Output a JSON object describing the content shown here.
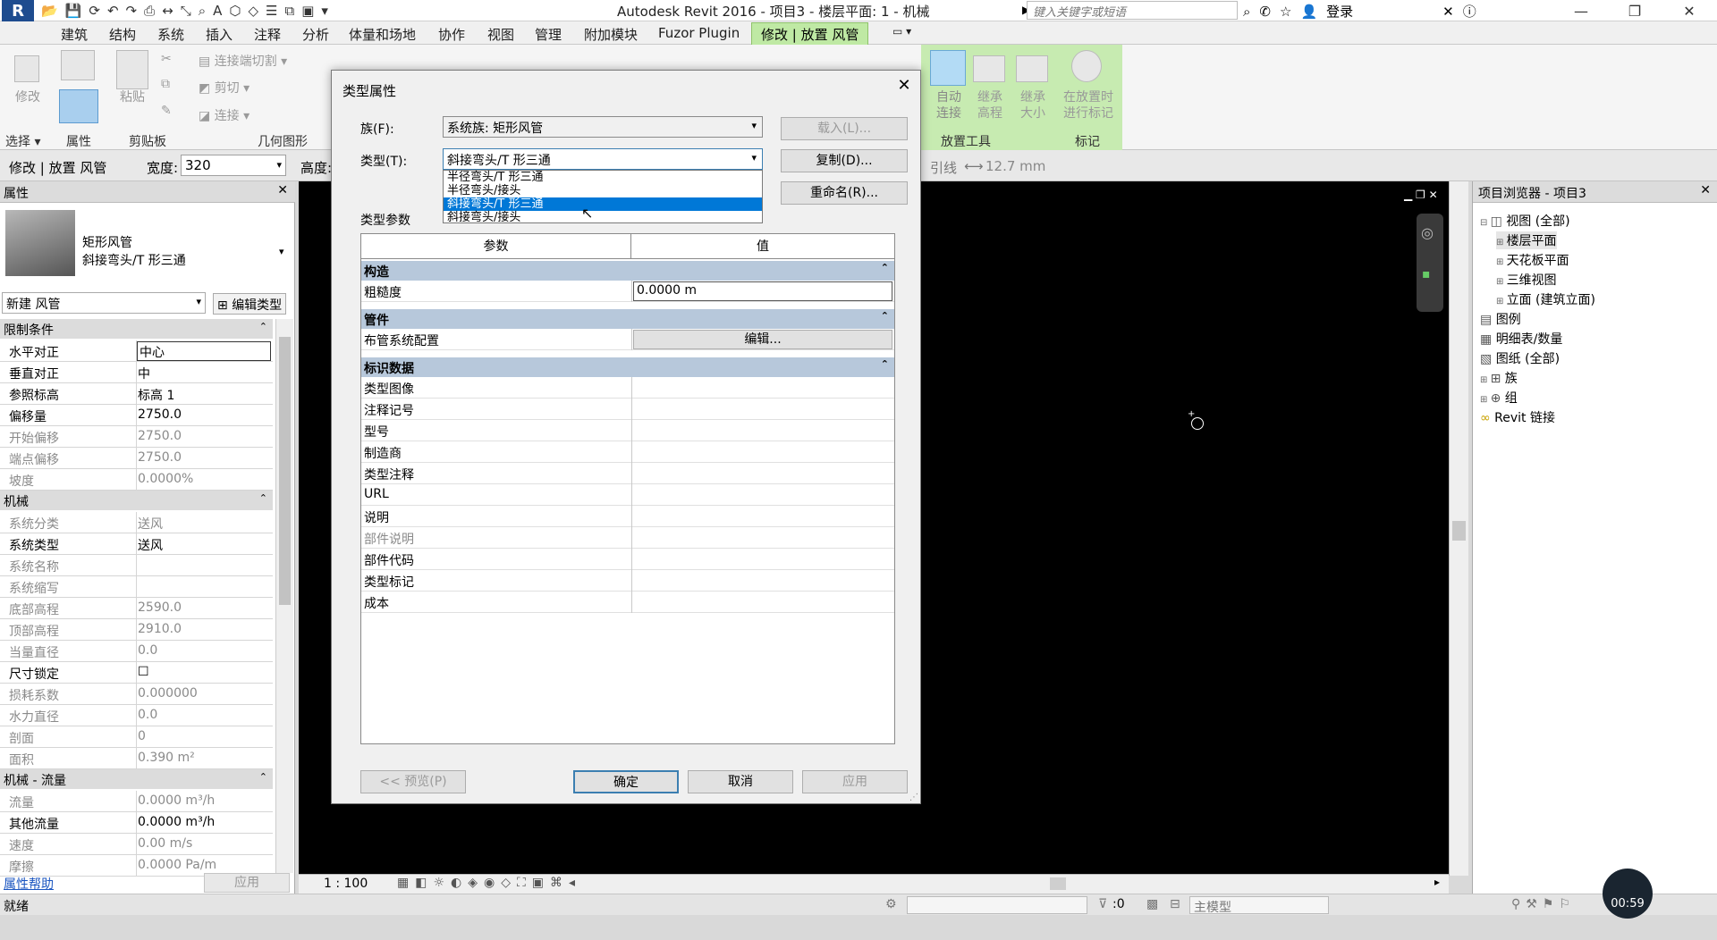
{
  "titlebar": {
    "app_letter": "R",
    "title": "Autodesk Revit 2016 -     项目3 - 楼层平面: 1 - 机械",
    "search_placeholder": "键入关键字或短语",
    "login_label": "登录"
  },
  "ribbon_tabs": [
    "建筑",
    "结构",
    "系统",
    "插入",
    "注释",
    "分析",
    "体量和场地",
    "协作",
    "视图",
    "管理",
    "附加模块",
    "Fuzor Plugin"
  ],
  "ribbon_active_tab": "修改 | 放置 风管",
  "ribbon": {
    "modify": "修改",
    "paste": "粘贴",
    "cope": "连接端切割",
    "cut": "剪切",
    "join": "连接",
    "auto_connect": [
      "自动",
      "连接"
    ],
    "inherit_elev": [
      "继承",
      "高程"
    ],
    "inherit_size": [
      "继承",
      "大小"
    ],
    "tag_on_place": [
      "在放置时",
      "进行标记"
    ],
    "panel_select": "选择",
    "panel_props": "属性",
    "panel_clipboard": "剪贴板",
    "panel_geometry": "几何图形",
    "panel_place_tools": "放置工具",
    "panel_tag": "标记"
  },
  "optbar": {
    "context": "修改 | 放置 风管",
    "width_label": "宽度:",
    "width_value": "320",
    "height_label": "高度:",
    "leader_label": "引线",
    "leader_value": "12.7 mm"
  },
  "properties": {
    "header": "属性",
    "type_family": "矩形风管",
    "type_name": "斜接弯头/T 形三通",
    "instance_filter": "新建 风管",
    "edit_type": "编辑类型",
    "sections": {
      "constraints": "限制条件",
      "mechanical": "机械",
      "mech_flow": "机械 - 流量"
    },
    "constraint_rows": [
      {
        "k": "水平对正",
        "v": "中心"
      },
      {
        "k": "垂直对正",
        "v": "中"
      },
      {
        "k": "参照标高",
        "v": "标高 1"
      },
      {
        "k": "偏移量",
        "v": "2750.0"
      },
      {
        "k": "开始偏移",
        "v": "2750.0"
      },
      {
        "k": "端点偏移",
        "v": "2750.0"
      },
      {
        "k": "坡度",
        "v": "0.0000%"
      }
    ],
    "mech_rows": [
      {
        "k": "系统分类",
        "v": "送风"
      },
      {
        "k": "系统类型",
        "v": "送风"
      },
      {
        "k": "系统名称",
        "v": ""
      },
      {
        "k": "系统缩写",
        "v": ""
      },
      {
        "k": "底部高程",
        "v": "2590.0"
      },
      {
        "k": "顶部高程",
        "v": "2910.0"
      },
      {
        "k": "当量直径",
        "v": "0.0"
      },
      {
        "k": "尺寸锁定",
        "v": "☐"
      },
      {
        "k": "损耗系数",
        "v": "0.000000"
      },
      {
        "k": "水力直径",
        "v": "0.0"
      },
      {
        "k": "剖面",
        "v": "0"
      },
      {
        "k": "面积",
        "v": "0.390 m²"
      }
    ],
    "flow_rows": [
      {
        "k": "流量",
        "v": "0.0000 m³/h"
      },
      {
        "k": "其他流量",
        "v": "0.0000 m³/h"
      },
      {
        "k": "速度",
        "v": "0.00 m/s"
      },
      {
        "k": "摩擦",
        "v": "0.0000 Pa/m"
      }
    ],
    "help_link": "属性帮助",
    "apply": "应用"
  },
  "browser": {
    "header": "项目浏览器 - 项目3",
    "items": [
      {
        "label": "视图 (全部)",
        "indent": 0
      },
      {
        "label": "楼层平面",
        "indent": 1
      },
      {
        "label": "天花板平面",
        "indent": 1
      },
      {
        "label": "三维视图",
        "indent": 1
      },
      {
        "label": "立面 (建筑立面)",
        "indent": 1
      },
      {
        "label": "图例",
        "indent": 0
      },
      {
        "label": "明细表/数量",
        "indent": 0
      },
      {
        "label": "图纸 (全部)",
        "indent": 0
      },
      {
        "label": "族",
        "indent": 0
      },
      {
        "label": "组",
        "indent": 0
      },
      {
        "label": "Revit 链接",
        "indent": 0
      }
    ]
  },
  "viewbar": {
    "scale": "1 : 100"
  },
  "status": {
    "text": "就绪",
    "count": ":0",
    "model": "主模型"
  },
  "timer": "00:59",
  "dialog": {
    "title": "类型属性",
    "family_label": "族(F):",
    "family_value": "系统族: 矩形风管",
    "type_label": "类型(T):",
    "type_value": "斜接弯头/T 形三通",
    "load_btn": "载入(L)...",
    "dup_btn": "复制(D)...",
    "rename_btn": "重命名(R)...",
    "type_params": "类型参数",
    "dropdown_options": [
      "半径弯头/T 形三通",
      "半径弯头/接头",
      "斜接弯头/T 形三通",
      "斜接弯头/接头"
    ],
    "dropdown_selected": 2,
    "col_param": "参数",
    "col_value": "值",
    "sec_construction": "构造",
    "roughness": "粗糙度",
    "roughness_value": "0.0000 m",
    "sec_piping": "管件",
    "routing": "布管系统配置",
    "edit_btn": "编辑...",
    "sec_identity": "标识数据",
    "identity_rows": [
      "类型图像",
      "注释记号",
      "型号",
      "制造商",
      "类型注释",
      "URL",
      "说明",
      "部件说明",
      "部件代码",
      "类型标记",
      "成本"
    ],
    "preview_btn": "<< 预览(P)",
    "ok_btn": "确定",
    "cancel_btn": "取消",
    "apply_btn": "应用"
  }
}
